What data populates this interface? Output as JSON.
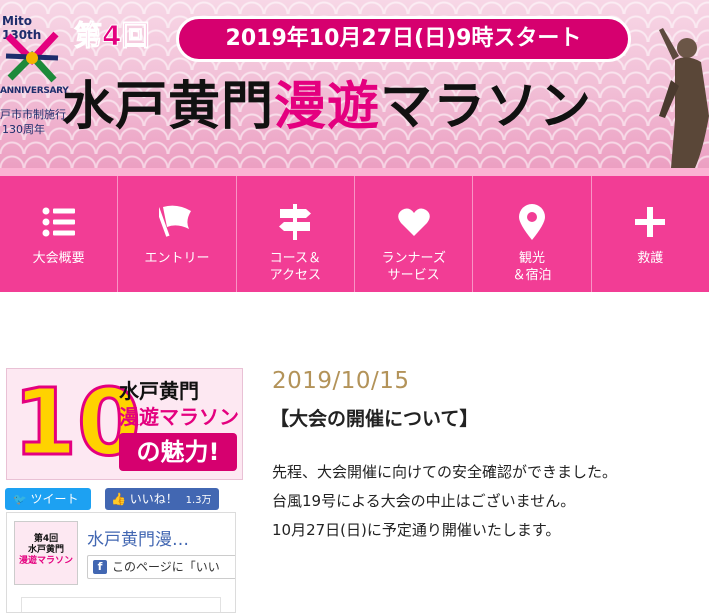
{
  "header": {
    "logo": {
      "mito": "Mito 130th",
      "anniversary": "ANNIVERSARY",
      "city": "戸市市制施行",
      "years": "130周年"
    },
    "edition": "第4回",
    "date_label": "2019年10月27日(日)9時スタート",
    "title_prefix": "水戸黄門",
    "title_highlight": "漫遊",
    "title_suffix": "マラソン"
  },
  "nav": {
    "items": [
      {
        "label": "大会概要",
        "icon": "list-icon"
      },
      {
        "label": "エントリー",
        "icon": "flag-icon"
      },
      {
        "label": "コース＆\nアクセス",
        "icon": "signpost-icon"
      },
      {
        "label": "ランナーズ\nサービス",
        "icon": "heart-icon"
      },
      {
        "label": "観光\n＆宿泊",
        "icon": "map-pin-icon"
      },
      {
        "label": "救護",
        "icon": "plus-icon"
      }
    ]
  },
  "sidebar": {
    "banner": {
      "number": "10",
      "line1": "水戸黄門",
      "line2": "漫遊マラソン",
      "line3": "の魅力!"
    },
    "tweet_label": "ツイート",
    "like_label": "いいね！",
    "like_count": "1.3万",
    "fb_page": {
      "name": "水戸黄門漫…",
      "share_label": "このページに「いい",
      "thumb_line1": "第4回",
      "thumb_line2": "水戸黄門",
      "thumb_line3": "漫遊マラソン"
    }
  },
  "post": {
    "date": "2019/10/15",
    "title": "【大会の開催について】",
    "body": [
      "先程、大会開催に向けての安全確認ができました。",
      "台風19号による大会の中止はございません。",
      "10月27日(日)に予定通り開催いたします。"
    ]
  },
  "colors": {
    "nav_bg": "#f23d95",
    "accent_pink": "#e4007f",
    "date_pill": "#d6006f",
    "post_date": "#b39359"
  }
}
